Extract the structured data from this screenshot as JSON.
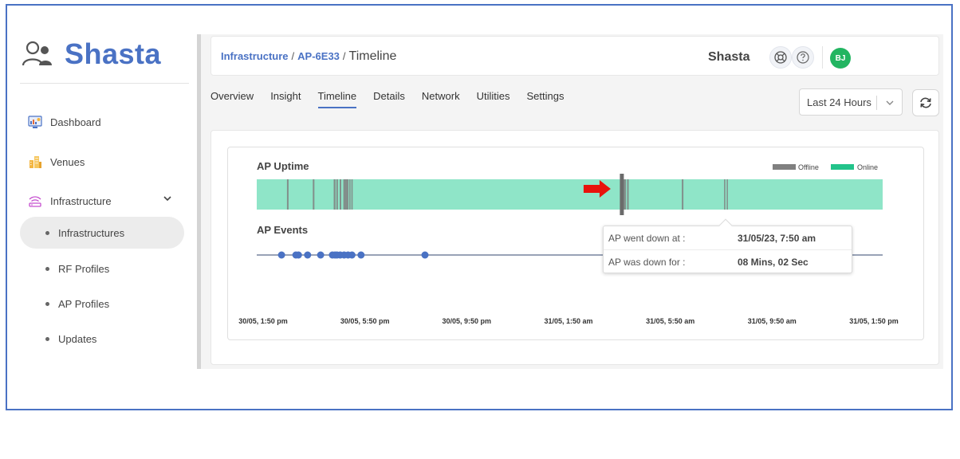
{
  "brand": {
    "name": "Shasta",
    "color": "#4a72c4"
  },
  "sidebar": {
    "items": [
      {
        "label": "Dashboard",
        "icon": "dashboard-icon"
      },
      {
        "label": "Venues",
        "icon": "venues-icon"
      },
      {
        "label": "Infrastructure",
        "icon": "wifi-icon",
        "expanded": true
      }
    ],
    "sub_items": [
      {
        "label": "Infrastructures",
        "active": true
      },
      {
        "label": "RF Profiles",
        "active": false
      },
      {
        "label": "AP Profiles",
        "active": false
      },
      {
        "label": "Updates",
        "active": false
      }
    ]
  },
  "header": {
    "breadcrumb": {
      "root": "Infrastructure",
      "sep1": "/",
      "ap": "AP-6E33",
      "sep2": "/",
      "current": "Timeline"
    },
    "org_name": "Shasta",
    "user_initials": "BJ",
    "icons": [
      "support-icon",
      "help-icon"
    ]
  },
  "tabs": [
    {
      "label": "Overview",
      "active": false
    },
    {
      "label": "Insight",
      "active": false
    },
    {
      "label": "Timeline",
      "active": true
    },
    {
      "label": "Details",
      "active": false
    },
    {
      "label": "Network",
      "active": false
    },
    {
      "label": "Utilities",
      "active": false
    },
    {
      "label": "Settings",
      "active": false
    }
  ],
  "range_select": {
    "value": "Last 24 Hours"
  },
  "timeline": {
    "uptime_title": "AP Uptime",
    "events_title": "AP Events",
    "legend": [
      {
        "label": "Offline",
        "color": "#808080"
      },
      {
        "label": "Online",
        "color": "#22c38a"
      }
    ],
    "uptime_bar_color": "#8fe5c8",
    "axis_start": "30/05, 1:50 pm",
    "axis_end": "31/05, 1:50 pm",
    "axis_hours": 24,
    "axis_labels": [
      "30/05, 1:50 pm",
      "30/05, 5:50 pm",
      "30/05, 9:50 pm",
      "31/05, 1:50 am",
      "31/05, 5:50 am",
      "31/05, 9:50 am",
      "31/05, 1:50 pm"
    ],
    "offline_periods_hours": [
      [
        1.16,
        1.22
      ],
      [
        2.15,
        2.21
      ],
      [
        2.95,
        3.02
      ],
      [
        3.05,
        3.11
      ],
      [
        3.18,
        3.24
      ],
      [
        3.32,
        3.52
      ],
      [
        3.55,
        3.58
      ],
      [
        3.63,
        3.68
      ],
      [
        14.07,
        14.16
      ],
      [
        14.2,
        14.26
      ],
      [
        16.3,
        16.36
      ],
      [
        17.92,
        17.97
      ],
      [
        18.02,
        18.06
      ]
    ],
    "event_times_hours": [
      0.95,
      1.5,
      1.6,
      1.95,
      2.45,
      2.9,
      3.0,
      3.08,
      3.2,
      3.35,
      3.5,
      3.65,
      4.0,
      6.45,
      18.05
    ],
    "event_color": "#4a72c4",
    "highlight_hours": 14.0,
    "tooltip": {
      "down_at_label": "AP went down at :",
      "down_at_value": "31/05/23, 7:50 am",
      "down_for_label": "AP was down for :",
      "down_for_value": "08 Mins, 02 Sec"
    },
    "arrow_color": "#e8120c"
  }
}
